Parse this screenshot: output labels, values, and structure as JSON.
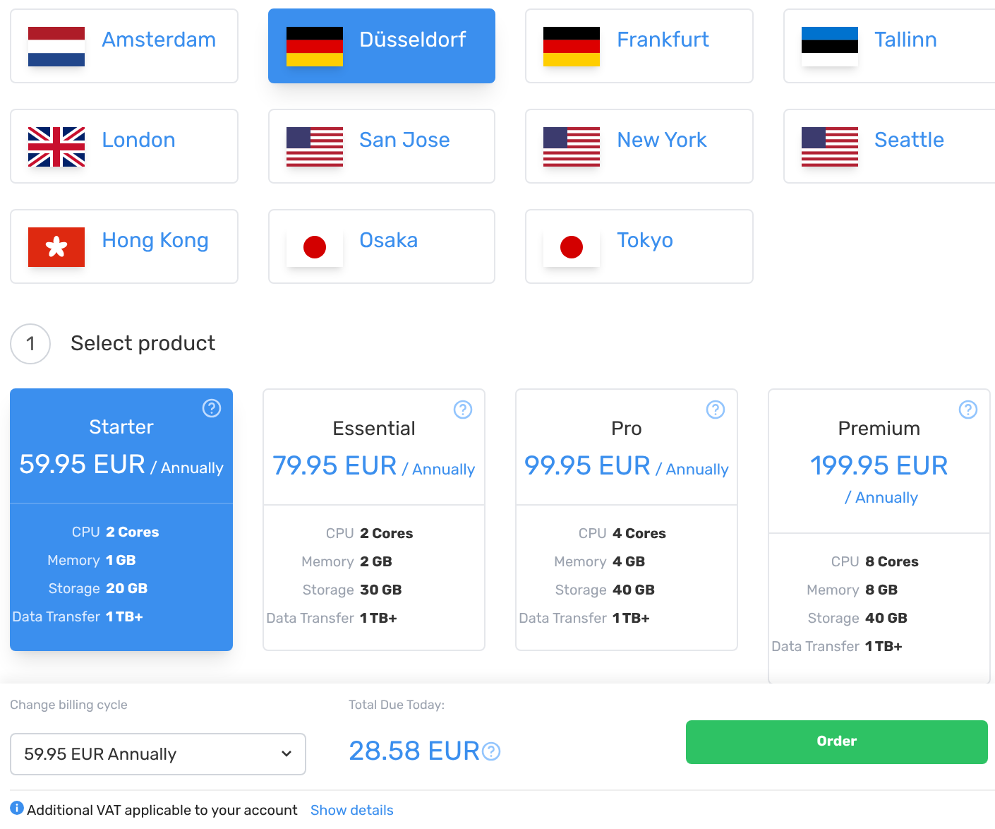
{
  "locations": [
    {
      "name": "Amsterdam",
      "kind": "nl",
      "selected": false
    },
    {
      "name": "Düsseldorf",
      "kind": "de",
      "selected": true
    },
    {
      "name": "Frankfurt",
      "kind": "de",
      "selected": false
    },
    {
      "name": "Tallinn",
      "kind": "ee",
      "selected": false
    },
    {
      "name": "London",
      "kind": "gb",
      "selected": false
    },
    {
      "name": "San Jose",
      "kind": "us",
      "selected": false
    },
    {
      "name": "New York",
      "kind": "us",
      "selected": false
    },
    {
      "name": "Seattle",
      "kind": "us",
      "selected": false
    },
    {
      "name": "Hong Kong",
      "kind": "hk",
      "selected": false
    },
    {
      "name": "Osaka",
      "kind": "jp",
      "selected": false
    },
    {
      "name": "Tokyo",
      "kind": "jp",
      "selected": false
    }
  ],
  "step": {
    "number": "1",
    "title": "Select product"
  },
  "products": [
    {
      "name": "Starter",
      "price": "59.95 EUR",
      "period": "/ Annually",
      "selected": true,
      "specs": [
        {
          "label": "CPU",
          "value": "2 Cores"
        },
        {
          "label": "Memory",
          "value": "1 GB"
        },
        {
          "label": "Storage",
          "value": "20 GB"
        },
        {
          "label": "Data Transfer",
          "value": "1 TB+"
        }
      ]
    },
    {
      "name": "Essential",
      "price": "79.95 EUR",
      "period": "/ Annually",
      "selected": false,
      "specs": [
        {
          "label": "CPU",
          "value": "2 Cores"
        },
        {
          "label": "Memory",
          "value": "2 GB"
        },
        {
          "label": "Storage",
          "value": "30 GB"
        },
        {
          "label": "Data Transfer",
          "value": "1 TB+"
        }
      ]
    },
    {
      "name": "Pro",
      "price": "99.95 EUR",
      "period": "/ Annually",
      "selected": false,
      "specs": [
        {
          "label": "CPU",
          "value": "4 Cores"
        },
        {
          "label": "Memory",
          "value": "4 GB"
        },
        {
          "label": "Storage",
          "value": "40 GB"
        },
        {
          "label": "Data Transfer",
          "value": "1 TB+"
        }
      ]
    },
    {
      "name": "Premium",
      "price": "199.95 EUR",
      "period": "/ Annually",
      "selected": false,
      "specs": [
        {
          "label": "CPU",
          "value": "8 Cores"
        },
        {
          "label": "Memory",
          "value": "8 GB"
        },
        {
          "label": "Storage",
          "value": "40 GB"
        },
        {
          "label": "Data Transfer",
          "value": "1 TB+"
        }
      ]
    }
  ],
  "billing": {
    "label": "Change billing cycle",
    "value": "59.95 EUR Annually"
  },
  "total": {
    "label": "Total Due Today:",
    "amount": "28.58 EUR"
  },
  "order_button": "Order",
  "vat_note": {
    "text": "Additional VAT applicable to your account",
    "link": "Show details"
  }
}
